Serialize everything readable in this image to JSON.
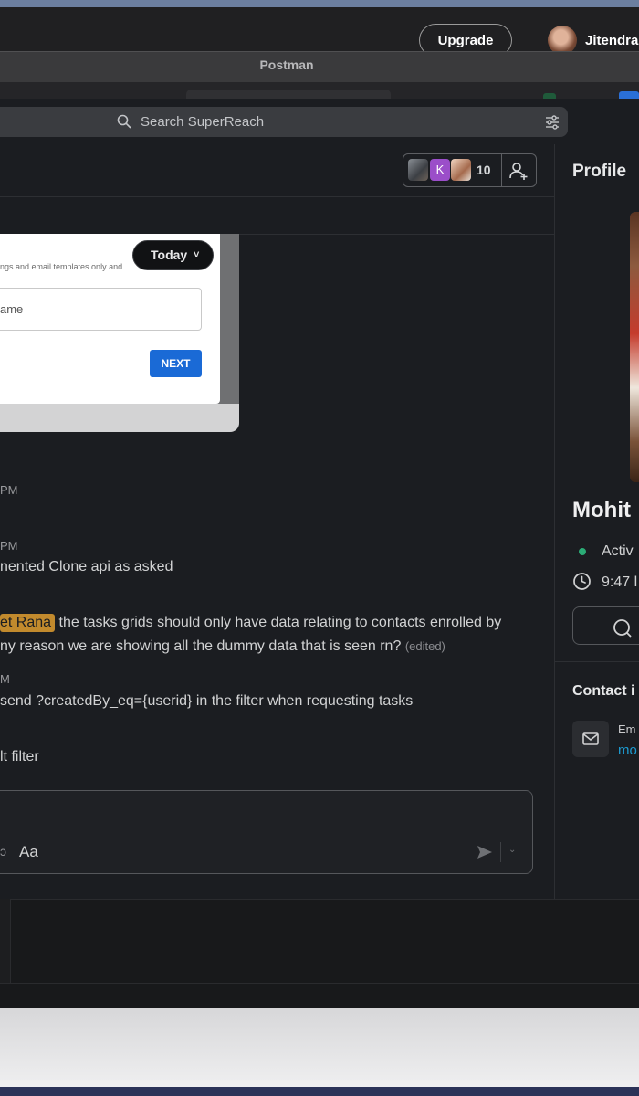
{
  "os_bar": {
    "upgrade_label": "Upgrade",
    "user_name": "Jitendra"
  },
  "window": {
    "title": "Postman"
  },
  "search": {
    "placeholder": "Search SuperReach"
  },
  "channel_header": {
    "member_initial": "K",
    "member_count": "10"
  },
  "preview": {
    "caption": "ngs and email templates only and",
    "input_text": "ame",
    "next_label": "NEXT"
  },
  "date_divider": {
    "label": "Today",
    "chevron": "˅"
  },
  "messages": [
    {
      "time": "PM"
    },
    {
      "time": "PM",
      "text": "nented Clone api as asked"
    },
    {
      "mention": "et Rana",
      "text": "the tasks grids should only have data relating to contacts enrolled by",
      "text2": "ny reason we are showing all the dummy data that is seen rn?",
      "edited": "(edited)"
    },
    {
      "time": "M",
      "text": " send ?createdBy_eq={userid} in the filter when requesting tasks"
    },
    {
      "text": "lt filter"
    }
  ],
  "composer": {
    "partial": "ↄ",
    "format_label": "Aa"
  },
  "profile": {
    "title": "Profile",
    "name": "Mohit",
    "status": "Activ",
    "local_time": "9:47 l",
    "contact_title": "Contact i",
    "email_label": "Em",
    "email_value": "mo",
    "status_color": "#2bac76"
  },
  "colors": {
    "mention_bg": "#c28a2d",
    "link": "#1d9bd1",
    "primary_button": "#1a6ad6"
  }
}
